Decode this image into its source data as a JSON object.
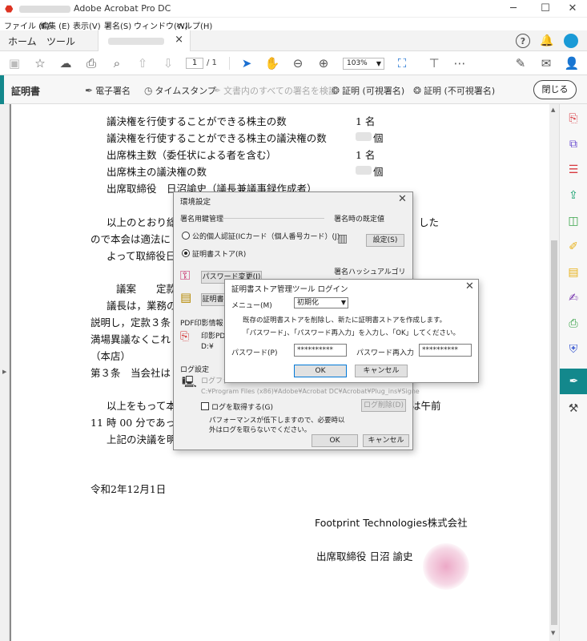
{
  "app": {
    "title": "Adobe Acrobat Pro DC",
    "menus": [
      "ファイル (F)",
      "編集 (E)",
      "表示(V)",
      "署名(S)",
      "ウィンドウ(W)",
      "ヘルプ(H)"
    ],
    "tabs": {
      "home": "ホーム",
      "tools": "ツール",
      "close_glyph": "×"
    }
  },
  "toolbar": {
    "current_page": "1",
    "page_total": "/ 1",
    "zoom": "103%"
  },
  "certificates": {
    "label": "証明書",
    "tools": {
      "digital_sign": "電子署名",
      "timestamp": "タイムスタンプ",
      "validate_all": "文書内のすべての署名を検証",
      "certify_visible": "証明 (可視署名)",
      "certify_invisible": "証明 (不可視署名)"
    },
    "close": "閉じる"
  },
  "document": {
    "lines": {
      "l1": "議決権を行使することができる株主の数",
      "l1v": "1 名",
      "l2": "議決権を行使することができる株主の議決権の数",
      "l2v": "個",
      "l3": "出席株主数（委任状による者を含む）",
      "l3v": "1 名",
      "l4": "出席株主の議決権の数",
      "l4v": "個",
      "l5": "出席取締役　日沼諭史（議長兼議事録作成者）",
      "p1a": "以上のとおり総",
      "p1b": "した",
      "p2": "ので本会は適法に",
      "p3": "よって取締役日",
      "g1": "議案　　定款変",
      "g2": "議長は，業務の",
      "g3": "説明し，定款３条",
      "g4": "満場異議なくこれ",
      "g5": "（本店）",
      "g6": "第３条　当会社は",
      "e1a": "以上をもって本",
      "e1b": "は午前",
      "e2": "11 時 00 分であっ",
      "e3": "上記の決議を明",
      "date": "令和2年12月1日",
      "company": "Footprint Technologies株式会社",
      "signer": "出席取締役 日沼 諭史"
    }
  },
  "prefs_dialog": {
    "title": "環境設定",
    "section_keys": "署名用鍵管理",
    "opt_jpki": "公的個人認証(ICカード（個人番号カード）(J)",
    "opt_store": "証明書ストア(R)",
    "btn_password_change": "パスワード変更(I)",
    "btn_cert": "証明書",
    "section_default": "署名時の既定値",
    "btn_settings": "設定(S)",
    "section_hash": "署名ハッシュアルゴリズム",
    "section_pdf": "PDF印影情報",
    "pdf_stamp_label": "印影PD",
    "pdf_path_prefix": "D:¥",
    "section_log": "ログ設定",
    "log_file_label": "ログファ",
    "log_path": "C:¥Program Files (x86)¥Adobe¥Acrobat DC¥Acrobat¥Plug_ins¥Signe",
    "chk_log": "ログを取得する(G)",
    "btn_log_delete": "ログ削除(D)",
    "perf_note_1": "パフォーマンスが低下しますので、必要時以",
    "perf_note_2": "外はログを取らないでください。",
    "ok": "OK",
    "cancel": "キャンセル"
  },
  "login_dialog": {
    "title": "証明書ストア管理ツール ログイン",
    "menu_label": "メニュー(M)",
    "menu_value": "初期化",
    "info_1": "既存の証明書ストアを削除し、新たに証明書ストアを作成します。",
    "info_2": "「パスワード」、「パスワード再入力」を入力し、「OK」してください。",
    "password_label": "パスワード(P)",
    "password_value": "**********",
    "password_re_label": "パスワード再入力",
    "password_re_value": "**********",
    "ok": "OK",
    "cancel": "キャンセル"
  }
}
